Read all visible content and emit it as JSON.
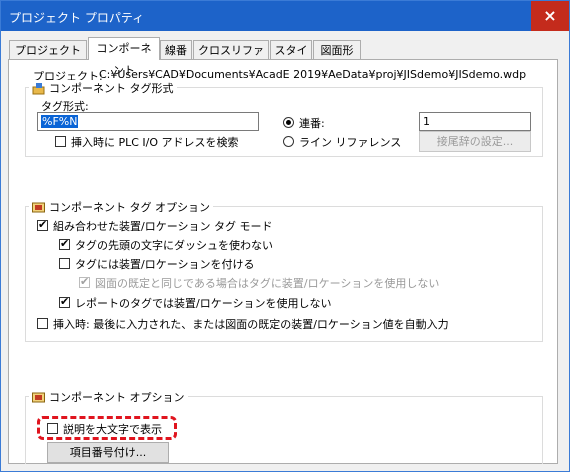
{
  "window": {
    "title": "プロジェクト プロパティ",
    "close_glyph": "×"
  },
  "tabs": [
    {
      "label": "プロジェクト設定",
      "active": false
    },
    {
      "label": "コンポーネント",
      "active": true
    },
    {
      "label": "線番",
      "active": false
    },
    {
      "label": "クロスリファレンス",
      "active": false
    },
    {
      "label": "スタイル",
      "active": false
    },
    {
      "label": "図面形式",
      "active": false
    }
  ],
  "project": {
    "label": "プロジェクト:",
    "path": "C:¥Users¥CAD¥Documents¥AcadE 2019¥AeData¥proj¥JISdemo¥JISdemo.wdp"
  },
  "tag_format": {
    "group_title": "コンポーネント タグ形式",
    "field_label": "タグ形式:",
    "field_value": "%F%N",
    "sequential_label": "連番:",
    "sequential_value": "1",
    "line_ref_label": "ライン リファレンス",
    "suffix_button": "接尾辞の設定...",
    "search_plc_label": "挿入時に PLC I/O アドレスを検索"
  },
  "tag_options": {
    "group_title": "コンポーネント タグ オプション",
    "items": [
      {
        "label": "組み合わせた装置/ロケーション タグ モード",
        "checked": true,
        "enabled": true
      },
      {
        "label": "タグの先頭の文字にダッシュを使わない",
        "checked": true,
        "enabled": true
      },
      {
        "label": "タグには装置/ロケーションを付ける",
        "checked": false,
        "enabled": true
      },
      {
        "label": "図面の既定と同じである場合はタグに装置/ロケーションを使用しない",
        "checked": true,
        "enabled": false
      },
      {
        "label": "レポートのタグでは装置/ロケーションを使用しない",
        "checked": true,
        "enabled": true
      },
      {
        "label": "挿入時: 最後に入力された、または図面の既定の装置/ロケーション値を自動入力",
        "checked": false,
        "enabled": true
      }
    ]
  },
  "comp_options": {
    "group_title": "コンポーネント オプション",
    "uppercase_label": "説明を大文字で表示",
    "uppercase_checked": false,
    "item_number_button": "項目番号付け..."
  },
  "colors": {
    "titlebar": "#1d63c9",
    "close": "#c42b1c",
    "annotation": "#e0141e",
    "selection": "#0a64d6"
  }
}
